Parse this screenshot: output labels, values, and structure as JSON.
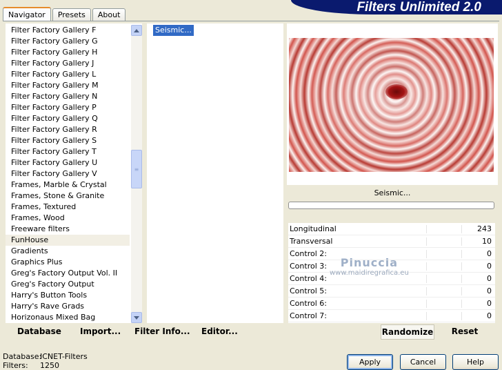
{
  "app": {
    "title": "Filters Unlimited 2.0"
  },
  "tabs": [
    {
      "label": "Navigator",
      "active": true
    },
    {
      "label": "Presets",
      "active": false
    },
    {
      "label": "About",
      "active": false
    }
  ],
  "filter_categories": {
    "items": [
      "Filter Factory Gallery F",
      "Filter Factory Gallery G",
      "Filter Factory Gallery H",
      "Filter Factory Gallery J",
      "Filter Factory Gallery L",
      "Filter Factory Gallery M",
      "Filter Factory Gallery N",
      "Filter Factory Gallery P",
      "Filter Factory Gallery Q",
      "Filter Factory Gallery R",
      "Filter Factory Gallery S",
      "Filter Factory Gallery T",
      "Filter Factory Gallery U",
      "Filter Factory Gallery V",
      "Frames, Marble & Crystal",
      "Frames, Stone & Granite",
      "Frames, Textured",
      "Frames, Wood",
      "Freeware filters",
      "FunHouse",
      "Gradients",
      "Graphics Plus",
      "Greg's Factory Output Vol. II",
      "Greg's Factory Output",
      "Harry's Button Tools",
      "Harry's Rave Grads",
      "Horizonaus Mixed Bag"
    ],
    "selected": "FunHouse",
    "icons": {
      "scroll_up": "chevron-up-icon",
      "scroll_down": "chevron-down-icon",
      "thumb_grip": "grip-icon"
    }
  },
  "effects": {
    "items": [
      "Seismic..."
    ],
    "selected": "Seismic..."
  },
  "preview": {
    "effect_name": "Seismic...",
    "progress": 0
  },
  "controls": [
    {
      "label": "Longitudinal",
      "value": "243"
    },
    {
      "label": "Transversal",
      "value": "10"
    },
    {
      "label": "Control 2:",
      "value": "0"
    },
    {
      "label": "Control 3:",
      "value": "0"
    },
    {
      "label": "Control 4:",
      "value": "0"
    },
    {
      "label": "Control 5:",
      "value": "0"
    },
    {
      "label": "Control 6:",
      "value": "0"
    },
    {
      "label": "Control 7:",
      "value": "0"
    }
  ],
  "watermark": {
    "name": "Pinuccia",
    "site": "www.maidiregrafica.eu"
  },
  "bottom_bar": {
    "database": "Database",
    "import": "Import...",
    "filter_info": "Filter Info...",
    "editor": "Editor...",
    "randomize": "Randomize",
    "reset": "Reset"
  },
  "status": {
    "database_label": "Database:",
    "database_value": "ICNET-Filters",
    "filters_label": "Filters:",
    "filters_value": "1250"
  },
  "dialog_buttons": {
    "apply": "Apply",
    "cancel": "Cancel",
    "help": "Help"
  },
  "colors": {
    "banner": "#0a1a6e",
    "selection": "#316ac5",
    "tab_accent": "#e68b2c",
    "window_bg": "#ece9d8"
  }
}
